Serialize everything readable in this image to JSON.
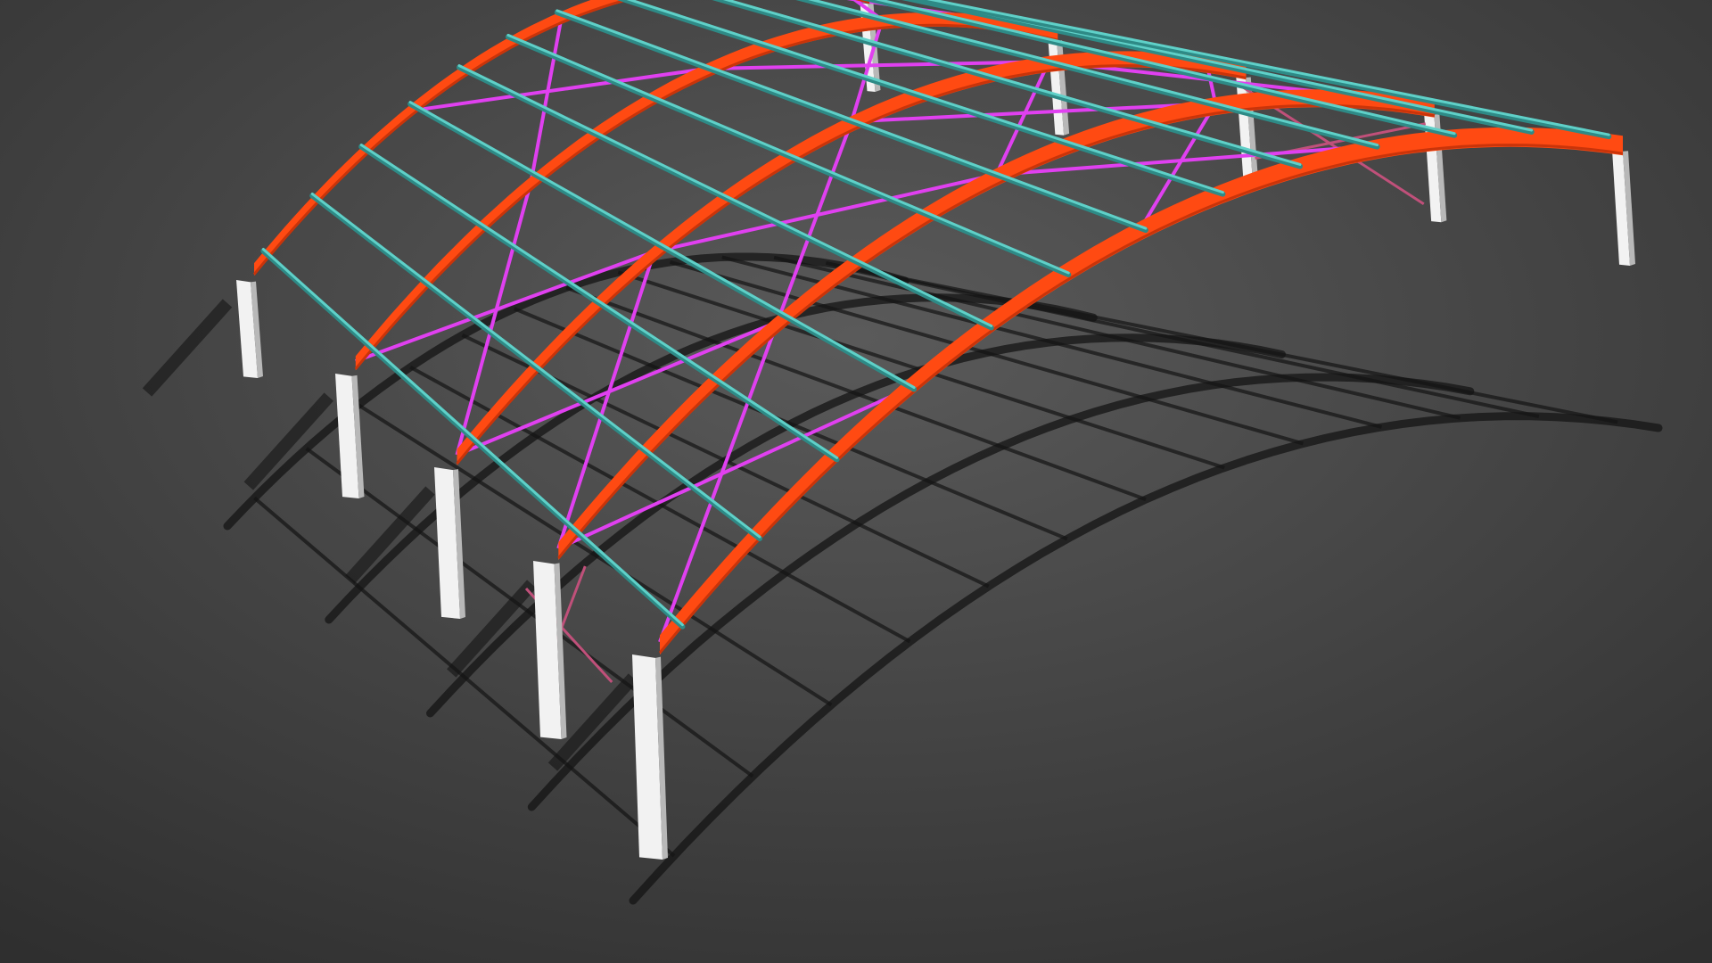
{
  "scene": {
    "subject": "arched-steel-frame-canopy-3d-model",
    "colors": {
      "background_top": "#5a5a5a",
      "background_bottom": "#2f2f2f",
      "arch_rafter": "#ff4a12",
      "arch_rafter_dark": "#c9340a",
      "purlin": "#5fd0c8",
      "purlin_dark": "#2e8a86",
      "bracing": "#e040f0",
      "column": "#f2f2f2",
      "column_shade": "#b8b8b8",
      "shadow": "#141414"
    },
    "counts": {
      "arch_frames": 5,
      "purlins": 13,
      "columns_per_side": 5
    }
  }
}
